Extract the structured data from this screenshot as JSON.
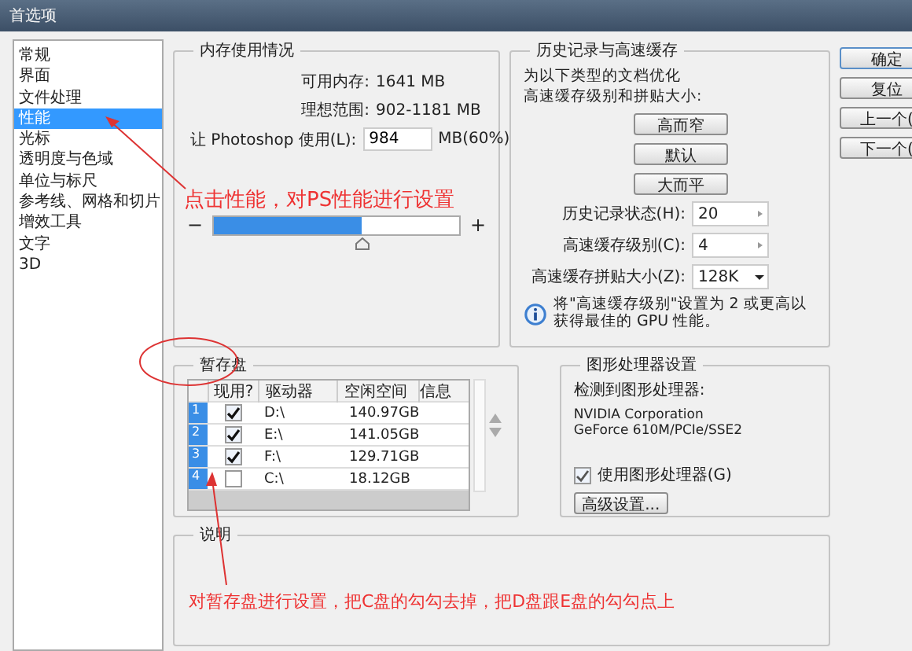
{
  "window": {
    "title": "首选项"
  },
  "sidebar": {
    "items": [
      {
        "label": "常规",
        "selected": false
      },
      {
        "label": "界面",
        "selected": false
      },
      {
        "label": "文件处理",
        "selected": false
      },
      {
        "label": "性能",
        "selected": true
      },
      {
        "label": "光标",
        "selected": false
      },
      {
        "label": "透明度与色域",
        "selected": false
      },
      {
        "label": "单位与标尺",
        "selected": false
      },
      {
        "label": "参考线、网格和切片",
        "selected": false
      },
      {
        "label": "增效工具",
        "selected": false
      },
      {
        "label": "文字",
        "selected": false
      },
      {
        "label": "3D",
        "selected": false
      }
    ]
  },
  "memory": {
    "title": "内存使用情况",
    "rows": [
      {
        "label": "可用内存:",
        "value": "1641 MB"
      },
      {
        "label": "理想范围:",
        "value": "902-1181 MB"
      }
    ],
    "use_label": "让 Photoshop 使用(L):",
    "use_value": "984",
    "use_suffix": "MB(60%)",
    "minus": "−",
    "plus": "+",
    "level": 0.6
  },
  "history": {
    "title": "历史记录与高速缓存",
    "intro": [
      "为以下类型的文档优化",
      "高速缓存级别和拼贴大小:"
    ],
    "presets": [
      "高而窄",
      "默认",
      "大而平"
    ],
    "fields": [
      {
        "kind": "spin",
        "label": "历史记录状态(H):",
        "value": "20"
      },
      {
        "kind": "spin",
        "label": "高速缓存级别(C):",
        "value": "4"
      },
      {
        "kind": "dropdown",
        "label": "高速缓存拼贴大小(Z):",
        "value": "128K"
      }
    ],
    "note": "将\"高速缓存级别\"设置为 2 或更高以获得最佳的 GPU 性能。"
  },
  "buttons": [
    "确定",
    "复位",
    "上一个(",
    "下一个("
  ],
  "scratch": {
    "title": "暂存盘",
    "columns": [
      "现用?",
      "驱动器",
      "空闲空间",
      "信息"
    ],
    "rows": [
      {
        "index": "1",
        "checked": true,
        "drive": "D:\\",
        "free": "140.97GB"
      },
      {
        "index": "2",
        "checked": true,
        "drive": "E:\\",
        "free": "141.05GB"
      },
      {
        "index": "3",
        "checked": true,
        "drive": "F:\\",
        "free": "129.71GB"
      },
      {
        "index": "4",
        "checked": false,
        "drive": "C:\\",
        "free": "18.12GB"
      }
    ]
  },
  "gpu": {
    "title": "图形处理器设置",
    "detected_label": "检测到图形处理器:",
    "vendor": "NVIDIA Corporation",
    "model": "GeForce 610M/PCIe/SSE2",
    "use_gpu": {
      "label": "使用图形处理器(G)",
      "checked": true
    },
    "advanced": "高级设置..."
  },
  "description": {
    "title": "说明"
  },
  "annotations": [
    "点击性能，对PS性能进行设置",
    "对暂存盘进行设置，把C盘的勾勾去掉，把D盘跟E盘的勾勾点上"
  ]
}
